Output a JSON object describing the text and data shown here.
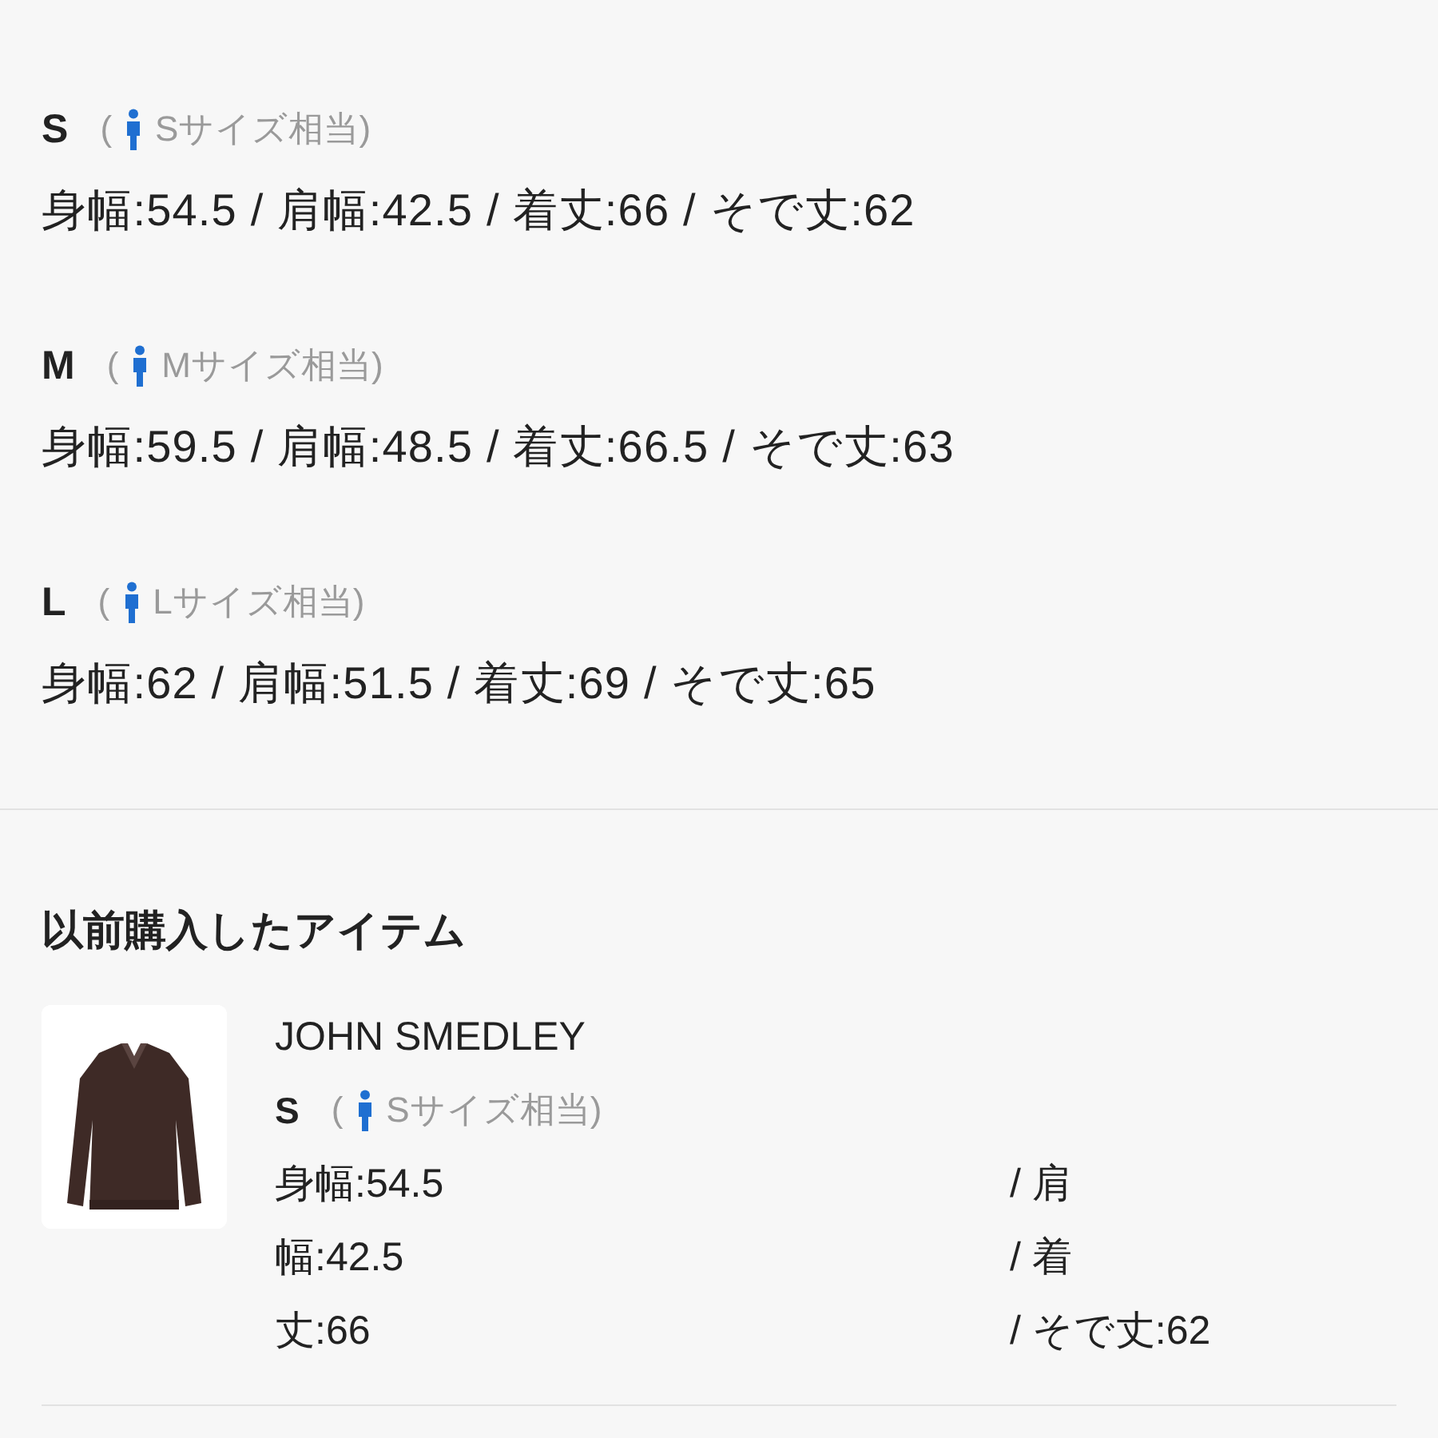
{
  "sizes": [
    {
      "size": "S",
      "paren": "(",
      "equivalent": "Sサイズ相当)",
      "measurements": "身幅:54.5 / 肩幅:42.5 / 着丈:66 / そで丈:62"
    },
    {
      "size": "M",
      "paren": "(",
      "equivalent": "Mサイズ相当)",
      "measurements": "身幅:59.5 / 肩幅:48.5 / 着丈:66.5 / そで丈:63"
    },
    {
      "size": "L",
      "paren": "(",
      "equivalent": "Lサイズ相当)",
      "measurements": "身幅:62 / 肩幅:51.5 / 着丈:69 / そで丈:65"
    }
  ],
  "purchased": {
    "heading": "以前購入したアイテム",
    "items": [
      {
        "kind": "picture",
        "brand": "JOHN SMEDLEY",
        "size": "S",
        "paren": "(",
        "equivalent": "Sサイズ相当)",
        "measurement_lines": [
          {
            "left": "身幅:54.5",
            "right": "/ 肩"
          },
          {
            "left": "幅:42.5",
            "right": "/ 着"
          },
          {
            "left": "丈:66",
            "right": "/ そで丈:62"
          }
        ]
      }
    ]
  }
}
